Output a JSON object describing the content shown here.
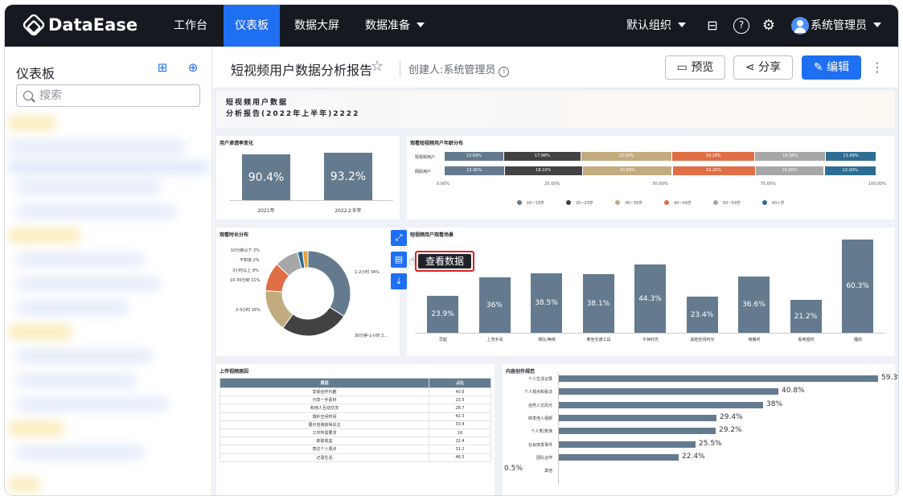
{
  "app": {
    "logo_text": "DataEase"
  },
  "topnav": {
    "items": [
      {
        "label": "工作台",
        "active": false
      },
      {
        "label": "仪表板",
        "active": true
      },
      {
        "label": "数据大屏",
        "active": false
      },
      {
        "label": "数据准备",
        "active": false
      }
    ],
    "org": "默认组织",
    "user": "系统管理员",
    "icons": [
      "toolbox-icon",
      "help-icon",
      "settings-icon"
    ]
  },
  "sidebar": {
    "title": "仪表板",
    "search_placeholder": "搜索",
    "icons": [
      "new-folder-icon",
      "new-dashboard-icon"
    ]
  },
  "dashboard": {
    "title": "短视频用户数据分析报告",
    "creator": "创建人:系统管理员",
    "buttons": {
      "preview": "预览",
      "share": "分享",
      "edit": "编辑"
    },
    "header_line1": "短视频用户数据",
    "header_line2": "分析报告(2022年上半年)2222"
  },
  "tooltip": {
    "text": "查看数据"
  },
  "kpi": {
    "title": "用户渗透率变化",
    "items": [
      {
        "label": "2021年",
        "value": "90.4%",
        "ratio": 0.9
      },
      {
        "label": "2022上半年",
        "value": "93.2%",
        "ratio": 0.93
      }
    ]
  },
  "age": {
    "title": "观看短视频用户年龄分布",
    "rows": [
      {
        "label": "短视频用户",
        "values": [
          "13.69%",
          "17.98%",
          "21.00%",
          "19.18%",
          "16.38%",
          "11.69%"
        ],
        "nums": [
          13.69,
          17.98,
          21.0,
          19.18,
          16.38,
          11.69
        ]
      },
      {
        "label": "网民用户",
        "values": [
          "13.90%",
          "18.10%",
          "20.80%",
          "19.20%",
          "16.00%",
          "12.00%"
        ],
        "nums": [
          13.9,
          18.1,
          20.8,
          19.2,
          16.0,
          12.0
        ]
      }
    ],
    "ticks": [
      "0.00%",
      "25.00%",
      "50.00%",
      "75.00%",
      "100.00%"
    ],
    "legend": [
      "10~19岁",
      "20~29岁",
      "30~39岁",
      "40~49岁",
      "50~59岁",
      "60+岁"
    ],
    "colors": [
      "#647b8f",
      "#424242",
      "#c2ab7f",
      "#e06e44",
      "#a7a7a7",
      "#2e6e94"
    ]
  },
  "duration": {
    "title": "观看时长分布",
    "labels": [
      "10分钟以下 2%",
      "不知道 2%",
      "3小时以上 9%",
      "10-30分钟 11%",
      "2-3小时 16%",
      "1-2小时 34%",
      "30分钟-1小时 2..."
    ],
    "slices": [
      {
        "value": 34,
        "color": "#647b8f"
      },
      {
        "value": 26,
        "color": "#424242"
      },
      {
        "value": 16,
        "color": "#c2ab7f"
      },
      {
        "value": 11,
        "color": "#e06e44"
      },
      {
        "value": 9,
        "color": "#a7a7a7"
      },
      {
        "value": 2,
        "color": "#2e6e94"
      },
      {
        "value": 2,
        "color": "#e8a33d"
      }
    ]
  },
  "scenes": {
    "title": "短视频用户观看场景",
    "categories": [
      "早起",
      "上洗手间",
      "排队/等候",
      "乘坐交通工具",
      "午休时光",
      "其他空闲时光",
      "用餐时",
      "看电视时",
      "睡前"
    ],
    "values": [
      23.9,
      36,
      38.5,
      38.1,
      44.3,
      23.4,
      36.6,
      21.2,
      60.3
    ],
    "labels": [
      "23.9%",
      "36%",
      "38.5%",
      "38.1%",
      "44.3%",
      "23.4%",
      "36.6%",
      "21.2%",
      "60.3%"
    ]
  },
  "reasons": {
    "title": "上传视频原因",
    "headers": [
      "原因",
      "占比"
    ],
    "rows": [
      [
        "享受创作乐趣",
        "40.6"
      ],
      [
        "分享一手素材",
        "23.5"
      ],
      [
        "和他人互动交流",
        "28.7"
      ],
      [
        "填补空闲时间",
        "42.3"
      ],
      [
        "展示自我获得关注",
        "33.4"
      ],
      [
        "工作所需要求",
        "16"
      ],
      [
        "获取收益",
        "22.4"
      ],
      [
        "表达个人观点",
        "31.2"
      ],
      [
        "记录生活",
        "46.5"
      ]
    ]
  },
  "content": {
    "title": "内容创作规范",
    "categories": [
      "个人生活记录",
      "个人观点和看法",
      "自然人文风光",
      "转发他人视频",
      "个人秀/表演",
      "社会突发事件",
      "团队合作",
      "其他"
    ],
    "values": [
      59.3,
      40.8,
      38,
      29.4,
      29.2,
      25.5,
      22.4,
      0.5
    ],
    "labels": [
      "59.3%",
      "40.8%",
      "38%",
      "29.4%",
      "29.2%",
      "25.5%",
      "22.4%",
      "0.5%"
    ]
  }
}
